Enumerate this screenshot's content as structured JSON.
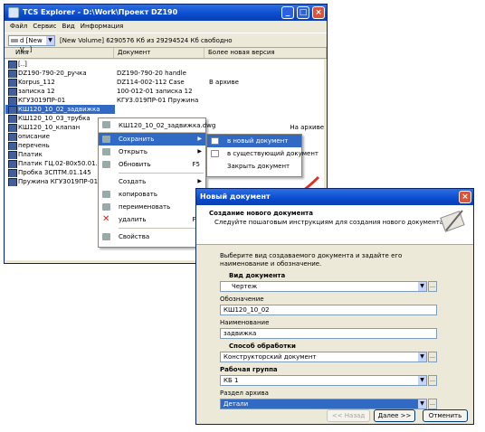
{
  "explorer": {
    "title": "TCS Explorer - D:\\Work\\Проект DZ190",
    "menu": [
      "Файл",
      "Сервис",
      "Вид",
      "Информация"
    ],
    "drive_select": "d [New V...]",
    "volume_info": "[New Volume] 6290576 Кб из 29294524 Кб свободно",
    "columns": [
      "Имя",
      "Документ",
      "Более новая версия"
    ],
    "rows": [
      {
        "name": "[..]",
        "doc": "",
        "newer": ""
      },
      {
        "name": "DZ190-790-20_ручка",
        "doc": "DZ190-790-20 handle",
        "newer": ""
      },
      {
        "name": "Korpus_112",
        "doc": "DZ114-002-112 Case",
        "newer": "В архиве"
      },
      {
        "name": "записка 12",
        "doc": "100-012-01 записка 12",
        "newer": ""
      },
      {
        "name": "КГУ3019ПР-01",
        "doc": "КГУ3.019ПР-01 Пружина",
        "newer": ""
      },
      {
        "name": "КШ120_10_02_задвижка",
        "doc": "",
        "newer": ""
      },
      {
        "name": "КШ120_10_03_трубка",
        "doc": "",
        "newer": ""
      },
      {
        "name": "КШ120_10_клапан",
        "doc": "",
        "newer": "На архиве"
      },
      {
        "name": "описание",
        "doc": "",
        "newer": ""
      },
      {
        "name": "перечень",
        "doc": "",
        "newer": ""
      },
      {
        "name": "Платик",
        "doc": "",
        "newer": ""
      },
      {
        "name": "Платик ГЦ.02-80х50.01.003",
        "doc": "",
        "newer": ""
      },
      {
        "name": "Пробка 3СПТМ.01.145",
        "doc": "",
        "newer": ""
      },
      {
        "name": "Пружина КГУ3019ПР-01",
        "doc": "",
        "newer": ""
      }
    ]
  },
  "context_menu": {
    "header": "КШ120_10_02_задвижка.dwg",
    "items": [
      {
        "label": "Сохранить",
        "shortcut": ""
      },
      {
        "label": "Открыть",
        "shortcut": ""
      },
      {
        "label": "Обновить",
        "shortcut": "F5"
      },
      {
        "label": "Создать",
        "shortcut": ""
      },
      {
        "label": "копировать",
        "shortcut": ""
      },
      {
        "label": "переименовать",
        "shortcut": ""
      },
      {
        "label": "удалить",
        "shortcut": "F8"
      },
      {
        "label": "Свойства",
        "shortcut": ""
      }
    ]
  },
  "submenu": [
    "в новый документ",
    "в существующий документ",
    "Закрыть документ"
  ],
  "dialog": {
    "title": "Новый документ",
    "header_title": "Создание нового документа",
    "header_sub": "Следуйте пошаговым инструкциям для создания нового документа",
    "intro": "Выберите вид создаваемого документа и задайте его наименование и обозначение.",
    "doc_type_label": "Вид документа",
    "doc_type_value": "Чертеж",
    "designation_label": "Обозначение",
    "designation_value": "КШ120_10_02",
    "name_label": "Наименование",
    "name_value": "задвижка",
    "processing_label": "Способ обработки",
    "processing_value": "Конструкторский документ",
    "group_label": "Рабочая группа",
    "group_value": "КБ 1",
    "archive_label": "Раздел архива",
    "archive_value": "Детали",
    "back_label": "<< Назад",
    "next_label": "Далее >>",
    "cancel_label": "Отменить"
  },
  "colors": {
    "accent": "#316ac5",
    "arrow": "#e0301e"
  }
}
